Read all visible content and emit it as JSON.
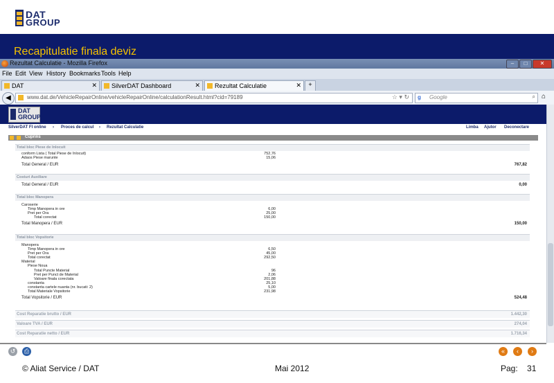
{
  "slide": {
    "logo_line1": "DAT",
    "logo_line2": "GROUP",
    "title": "Recapitulatie finala deviz",
    "footer_left": "© Aliat Service / DAT",
    "footer_mid": "Mai 2012",
    "footer_page_label": "Pag:",
    "footer_page_number": "31"
  },
  "browser": {
    "window_title": "Rezultat Calculatie - Mozilla Firefox",
    "window_buttons": [
      "–",
      "□",
      "✕"
    ],
    "menu": [
      "File",
      "Edit",
      "View",
      "History",
      "Bookmarks",
      "Tools",
      "Help"
    ],
    "tabs": [
      {
        "label": "DAT",
        "active": false
      },
      {
        "label": "SilverDAT Dashboard",
        "active": false
      },
      {
        "label": "Rezultat Calculatie",
        "active": true
      }
    ],
    "new_tab": "+",
    "url": "www.dat.de/VehicleRepairOnline/vehicleRepairOnline/calculationResult.html?cid=79189",
    "search_placeholder": "Google"
  },
  "app": {
    "logo_line1": "DAT",
    "logo_line2": "GROUP",
    "breadcrumbs": [
      "SilverDAT FI online",
      "Proces de calcul",
      "Rezultat Calculatie"
    ],
    "top_links": [
      "Limba",
      "Ajutor",
      "Deconectare"
    ],
    "section_title": "Cuprins",
    "sections": {
      "piese": {
        "header": "Total bloc Piese de înlocuit",
        "rows": [
          {
            "label": "conform Lista ( Total Piese de înlocuit)",
            "value": "752,76"
          },
          {
            "label": "Adaos Piese marunte",
            "value": "15,06"
          }
        ],
        "total_label": "Total General / EUR",
        "total_value": "767,82"
      },
      "auxiliare": {
        "header": "Costuri Auxiliare",
        "total_label": "Total General / EUR",
        "total_value": "0,00"
      },
      "manopera": {
        "header": "Total bloc Manopera",
        "rows": [
          {
            "label": "Caroserie",
            "value": ""
          },
          {
            "label": "Timp Manopera in ore",
            "value": "6,00"
          },
          {
            "label": "Pret per Ora",
            "value": "25,00"
          },
          {
            "label": "Total corectat",
            "value": "150,00"
          }
        ],
        "total_label": "Total Manopera / EUR",
        "total_value": "150,00"
      },
      "vopsitorie": {
        "header": "Total bloc Vopsitorie",
        "rows": [
          {
            "label": "Manopera",
            "value": ""
          },
          {
            "label": "Timp Manopera in ore",
            "value": "6,50"
          },
          {
            "label": "Pret per Ora",
            "value": "45,00"
          },
          {
            "label": "Total corectat",
            "value": "292,50"
          },
          {
            "label": "Material",
            "value": ""
          },
          {
            "label": "Piese Noua",
            "value": ""
          },
          {
            "label": "Total Puncte Material",
            "value": "96"
          },
          {
            "label": "Pret per Punct de Material",
            "value": "2,06"
          },
          {
            "label": "Valoare finala corectata",
            "value": "201,88"
          },
          {
            "label": "constanta",
            "value": "25,10"
          },
          {
            "label": "constanta cartele nuanta (nr. bucati: 2)",
            "value": "5,00"
          },
          {
            "label": "Total Materiale Vopsitorie",
            "value": "231,98"
          }
        ],
        "total_label": "Total Vopsitorie / EUR",
        "total_value": "524,48"
      }
    },
    "summary": [
      {
        "label": "Cost Reparatie brutto / EUR",
        "value": "1.442,30"
      },
      {
        "label": "Valoare TVA / EUR",
        "value": "274,04"
      },
      {
        "label": "Cost Reparatie netto / EUR",
        "value": "1.716,34"
      }
    ]
  },
  "colors": {
    "navy": "#0c1b6a",
    "title_yellow": "#f5c200",
    "nav_orange": "#e07b14"
  }
}
